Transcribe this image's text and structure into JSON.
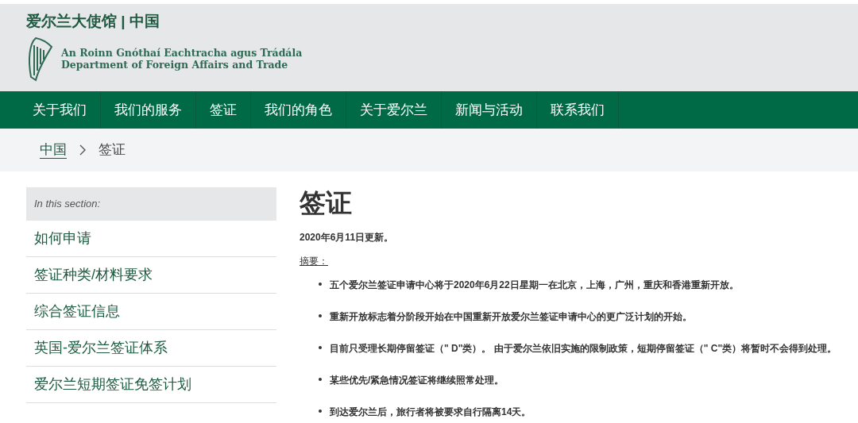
{
  "header": {
    "site_title": "爱尔兰大使馆 | 中国",
    "department_irish": "An Roinn Gnóthaí Eachtracha agus Trádála",
    "department_english": "Department of Foreign Affairs and Trade"
  },
  "nav": [
    {
      "label": "关于我们"
    },
    {
      "label": "我们的服务"
    },
    {
      "label": "签证"
    },
    {
      "label": "我们的角色"
    },
    {
      "label": "关于爱尔兰"
    },
    {
      "label": "新闻与活动"
    },
    {
      "label": "联系我们"
    }
  ],
  "breadcrumb": [
    {
      "label": "中国",
      "link": true
    },
    {
      "label": "签证",
      "link": false
    }
  ],
  "sidebar": {
    "heading": "In this section:",
    "items": [
      {
        "label": "如何申请"
      },
      {
        "label": "签证种类/材料要求"
      },
      {
        "label": "综合签证信息"
      },
      {
        "label": "英国-爱尔兰签证体系"
      },
      {
        "label": "爱尔兰短期签证免签计划"
      }
    ]
  },
  "article": {
    "title": "签证",
    "updated": "2020年6月11日更新。",
    "summary_label": "摘要：",
    "bullets": [
      "五个爱尔兰签证申请中心将于2020年6月22日星期一在北京，上海，广州，重庆和香港重新开放。",
      "重新开放标志着分阶段开始在中国重新开放爱尔兰签证申请中心的更广泛计划的开始。",
      "目前只受理长期停留签证（\" D\"类）。 由于爱尔兰依旧实施的限制政策，短期停留签证（\" C\"类）将暂时不会得到处理。",
      "某些优先/紧急情况签证将继续照常处理。",
      "到达爱尔兰后，旅行者将被要求自行隔离14天。"
    ]
  }
}
